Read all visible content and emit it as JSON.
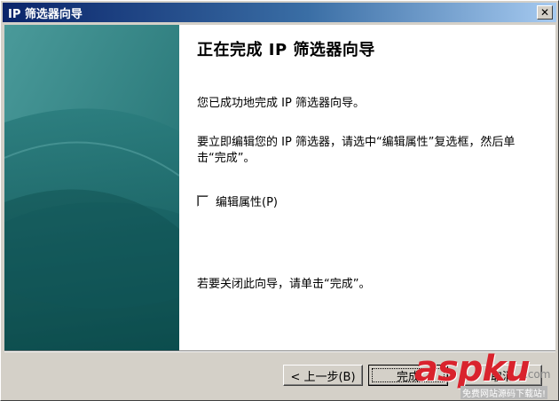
{
  "window": {
    "title": "IP 筛选器向导",
    "close_glyph": "✕"
  },
  "content": {
    "heading": "正在完成 IP 筛选器向导",
    "line1": "您已成功地完成 IP 筛选器向导。",
    "line2": "要立即编辑您的 IP 筛选器，请选中“编辑属性”复选框，然后单击“完成”。",
    "checkbox_label": "编辑属性(P)",
    "checkbox_checked": false,
    "line3": "若要关闭此向导，请单击“完成”。"
  },
  "buttons": {
    "back": "< 上一步(B)",
    "finish": "完成",
    "cancel": "取消"
  },
  "watermark": {
    "logo": "aspku",
    "com": ".com",
    "sub": "免费网站源码下载站!"
  },
  "colors": {
    "titlebar_start": "#0a246a",
    "side_panel": "#1f6b6b",
    "watermark_red": "#d9232d"
  }
}
